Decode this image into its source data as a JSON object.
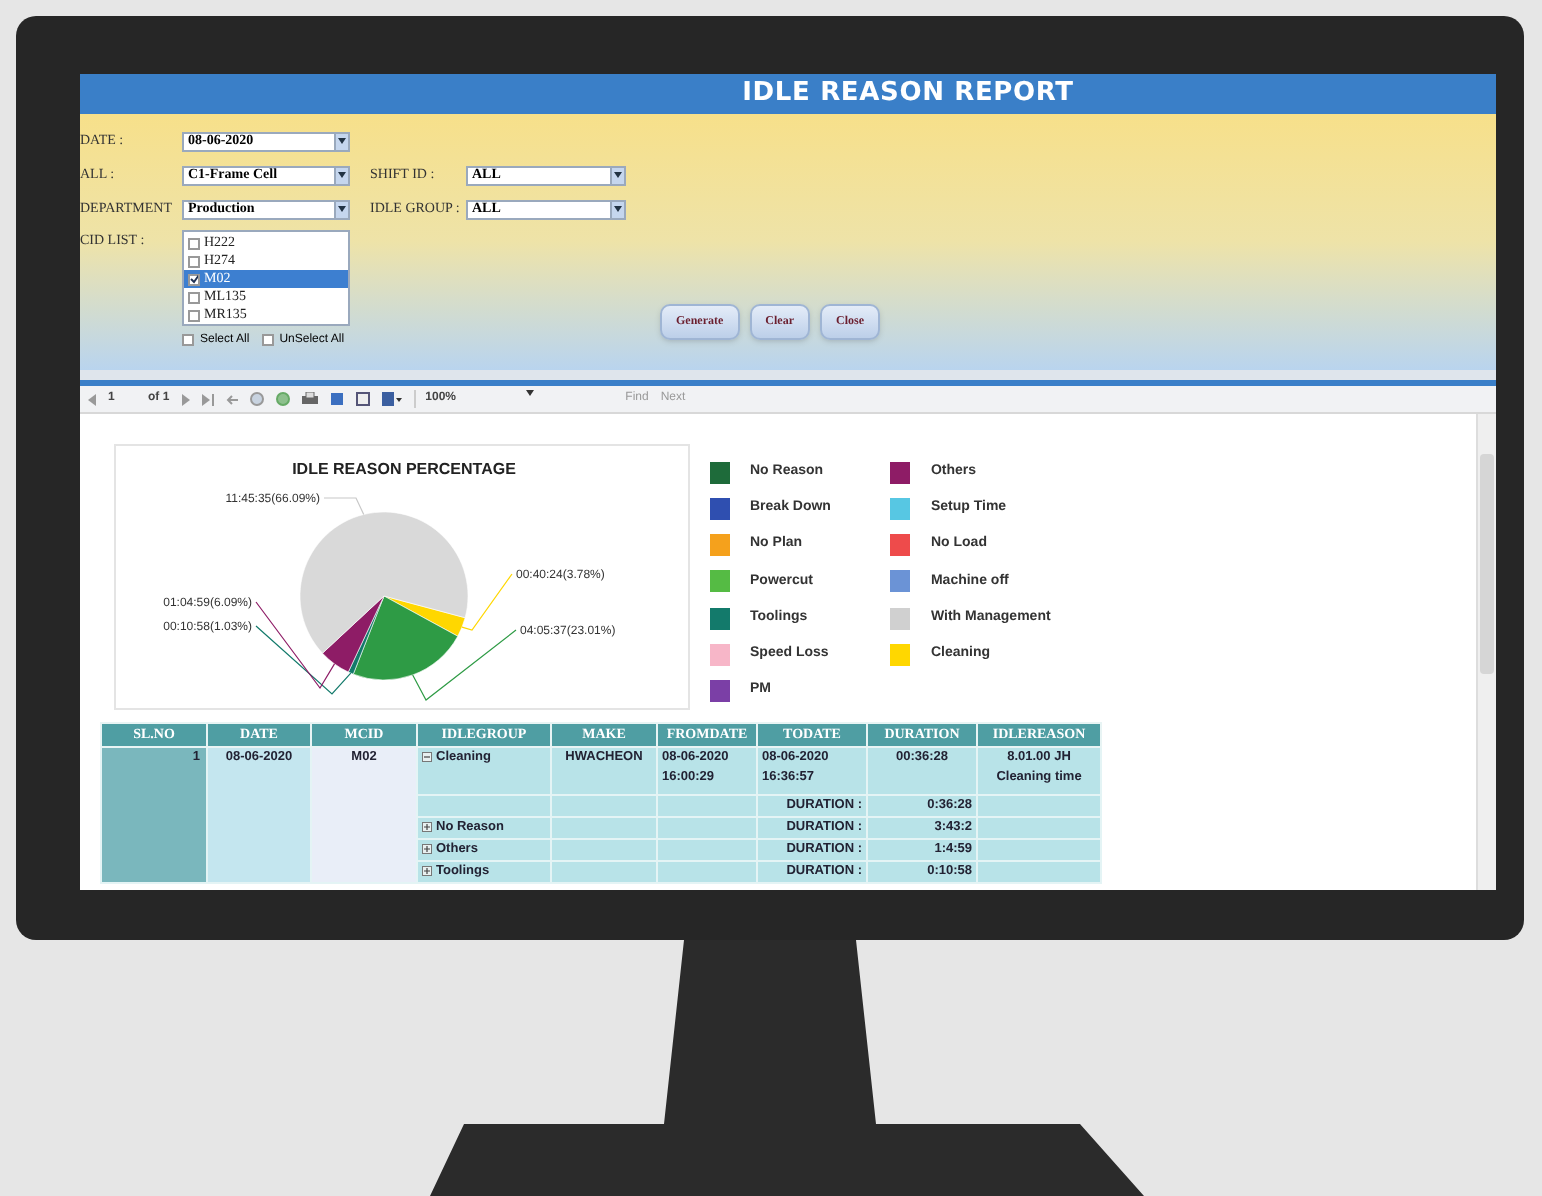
{
  "window": {
    "title": "IDLE REASON REPORT"
  },
  "filter_rows": [
    [
      {
        "label": "DATE :",
        "value": "08-06-2020"
      }
    ],
    [
      {
        "label": "ALL :",
        "value": "C1-Frame Cell"
      },
      {
        "label": "SHIFT ID :",
        "value": "ALL"
      }
    ],
    [
      {
        "label": "DEPARTMENT",
        "value": "Production"
      },
      {
        "label": "IDLE GROUP :",
        "value": "ALL"
      }
    ]
  ],
  "mcid_list": {
    "label": "CID LIST :",
    "items": [
      {
        "text": "H222",
        "checked": false,
        "selected": false
      },
      {
        "text": "H274",
        "checked": false,
        "selected": false
      },
      {
        "text": "M02",
        "checked": true,
        "selected": true
      },
      {
        "text": "ML135",
        "checked": false,
        "selected": false
      },
      {
        "text": "MR135",
        "checked": false,
        "selected": false
      }
    ]
  },
  "select_options": [
    {
      "label": "Select All",
      "checked": false
    },
    {
      "label": "UnSelect All",
      "checked": false
    }
  ],
  "buttons": [
    "Generate",
    "Clear",
    "Close"
  ],
  "toolbar": {
    "page": "1",
    "page_count": "of 1",
    "zoom": "100%",
    "find": "Find",
    "next": "Next"
  },
  "chart": {
    "chart_data": {
      "type": "pie",
      "title": "IDLE REASON PERCENTAGE",
      "values": [
        3.78,
        23.01,
        1.03,
        6.09,
        66.09
      ],
      "colors": [
        "#ffd700",
        "#2e9b45",
        "#137a6b",
        "#8e1c66",
        "#d9d9d9"
      ],
      "value_labels": [
        "00:40:24(3.78%)",
        "04:05:37(23.01%)",
        "00:10:58(1.03%)",
        "01:04:59(6.09%)",
        "11:45:35(66.09%)"
      ]
    },
    "legend": [
      {
        "label": "No Reason",
        "color": "#1e6b3a"
      },
      {
        "label": "Break Down",
        "color": "#2f4fb0"
      },
      {
        "label": "No Plan",
        "color": "#f5a11c"
      },
      {
        "label": "Powercut",
        "color": "#55bb44"
      },
      {
        "label": "Toolings",
        "color": "#137a6b"
      },
      {
        "label": "Speed Loss",
        "color": "#f7b6c8"
      },
      {
        "label": "PM",
        "color": "#7b3fa6"
      },
      {
        "label": "Others",
        "color": "#8e1c66"
      },
      {
        "label": "Setup Time",
        "color": "#57c7e3"
      },
      {
        "label": "No Load",
        "color": "#ee4b4b"
      },
      {
        "label": "Machine off",
        "color": "#6b93d6"
      },
      {
        "label": "With Management",
        "color": "#d0d0d0"
      },
      {
        "label": "Cleaning",
        "color": "#ffd700"
      }
    ]
  },
  "table": {
    "columns": [
      "SL.NO",
      "DATE",
      "MCID",
      "IDLEGROUP",
      "MAKE",
      "FROMDATE",
      "TODATE",
      "DURATION",
      "IDLEREASON"
    ],
    "sl_no": "1",
    "date": "08-06-2020",
    "mcid": "M02",
    "rows": [
      {
        "kind": "detail",
        "idlegroup": "Cleaning",
        "expanded": true,
        "make": "HWACHEON",
        "fromdate": "08-06-2020 16:00:29",
        "todate": "08-06-2020 16:36:57",
        "duration": "00:36:28",
        "idlereason": "8.01.00 JH Cleaning time"
      },
      {
        "kind": "subtotal",
        "label": "DURATION :",
        "duration": "0:36:28"
      },
      {
        "kind": "subtotal",
        "idlegroup": "No Reason",
        "expanded": false,
        "label": "DURATION :",
        "duration": "3:43:2"
      },
      {
        "kind": "subtotal",
        "idlegroup": "Others",
        "expanded": false,
        "label": "DURATION :",
        "duration": "1:4:59"
      },
      {
        "kind": "subtotal",
        "idlegroup": "Toolings",
        "expanded": false,
        "label": "DURATION :",
        "duration": "0:10:58"
      }
    ]
  }
}
